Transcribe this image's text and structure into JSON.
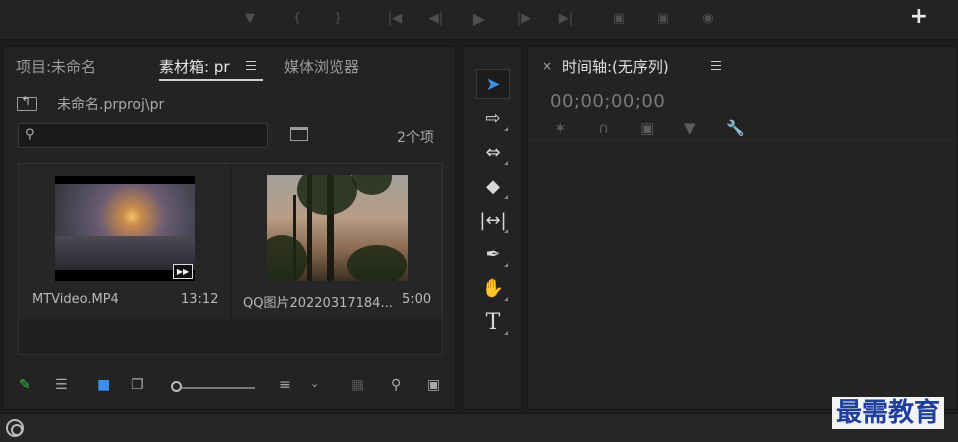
{
  "transport_icons": [
    "marker-icon",
    "mark-in-icon",
    "mark-out-icon",
    "go-to-in-icon",
    "step-back-icon",
    "play-icon",
    "step-forward-icon",
    "go-to-out-icon",
    "insert-icon",
    "overwrite-icon",
    "export-frame-icon"
  ],
  "add_button": "+",
  "project_panel": {
    "tabs": [
      {
        "label": "项目:未命名",
        "active": false
      },
      {
        "label": "素材箱: pr",
        "active": true
      },
      {
        "label": "媒体浏览器",
        "active": false
      }
    ],
    "path": "未命名.prproj\\pr",
    "search_placeholder": "",
    "item_count": "2个项",
    "items": [
      {
        "name": "MTVideo.MP4",
        "duration": "13:12"
      },
      {
        "name": "QQ图片20220317184...",
        "duration": "5:00"
      }
    ],
    "zoom_level": 0.0
  },
  "tools": [
    "selection-tool-icon",
    "track-select-tool-icon",
    "ripple-edit-tool-icon",
    "razor-tool-icon",
    "slip-tool-icon",
    "pen-tool-icon",
    "hand-tool-icon",
    "type-tool-icon"
  ],
  "timeline_panel": {
    "close": "×",
    "title": "时间轴:(无序列)",
    "timecode": "00;00;00;00"
  },
  "watermark": "最需教育",
  "colors": {
    "accent": "#3d8ee8",
    "pencil": "#3fbf3f",
    "watermark": "#1f3f9e"
  }
}
